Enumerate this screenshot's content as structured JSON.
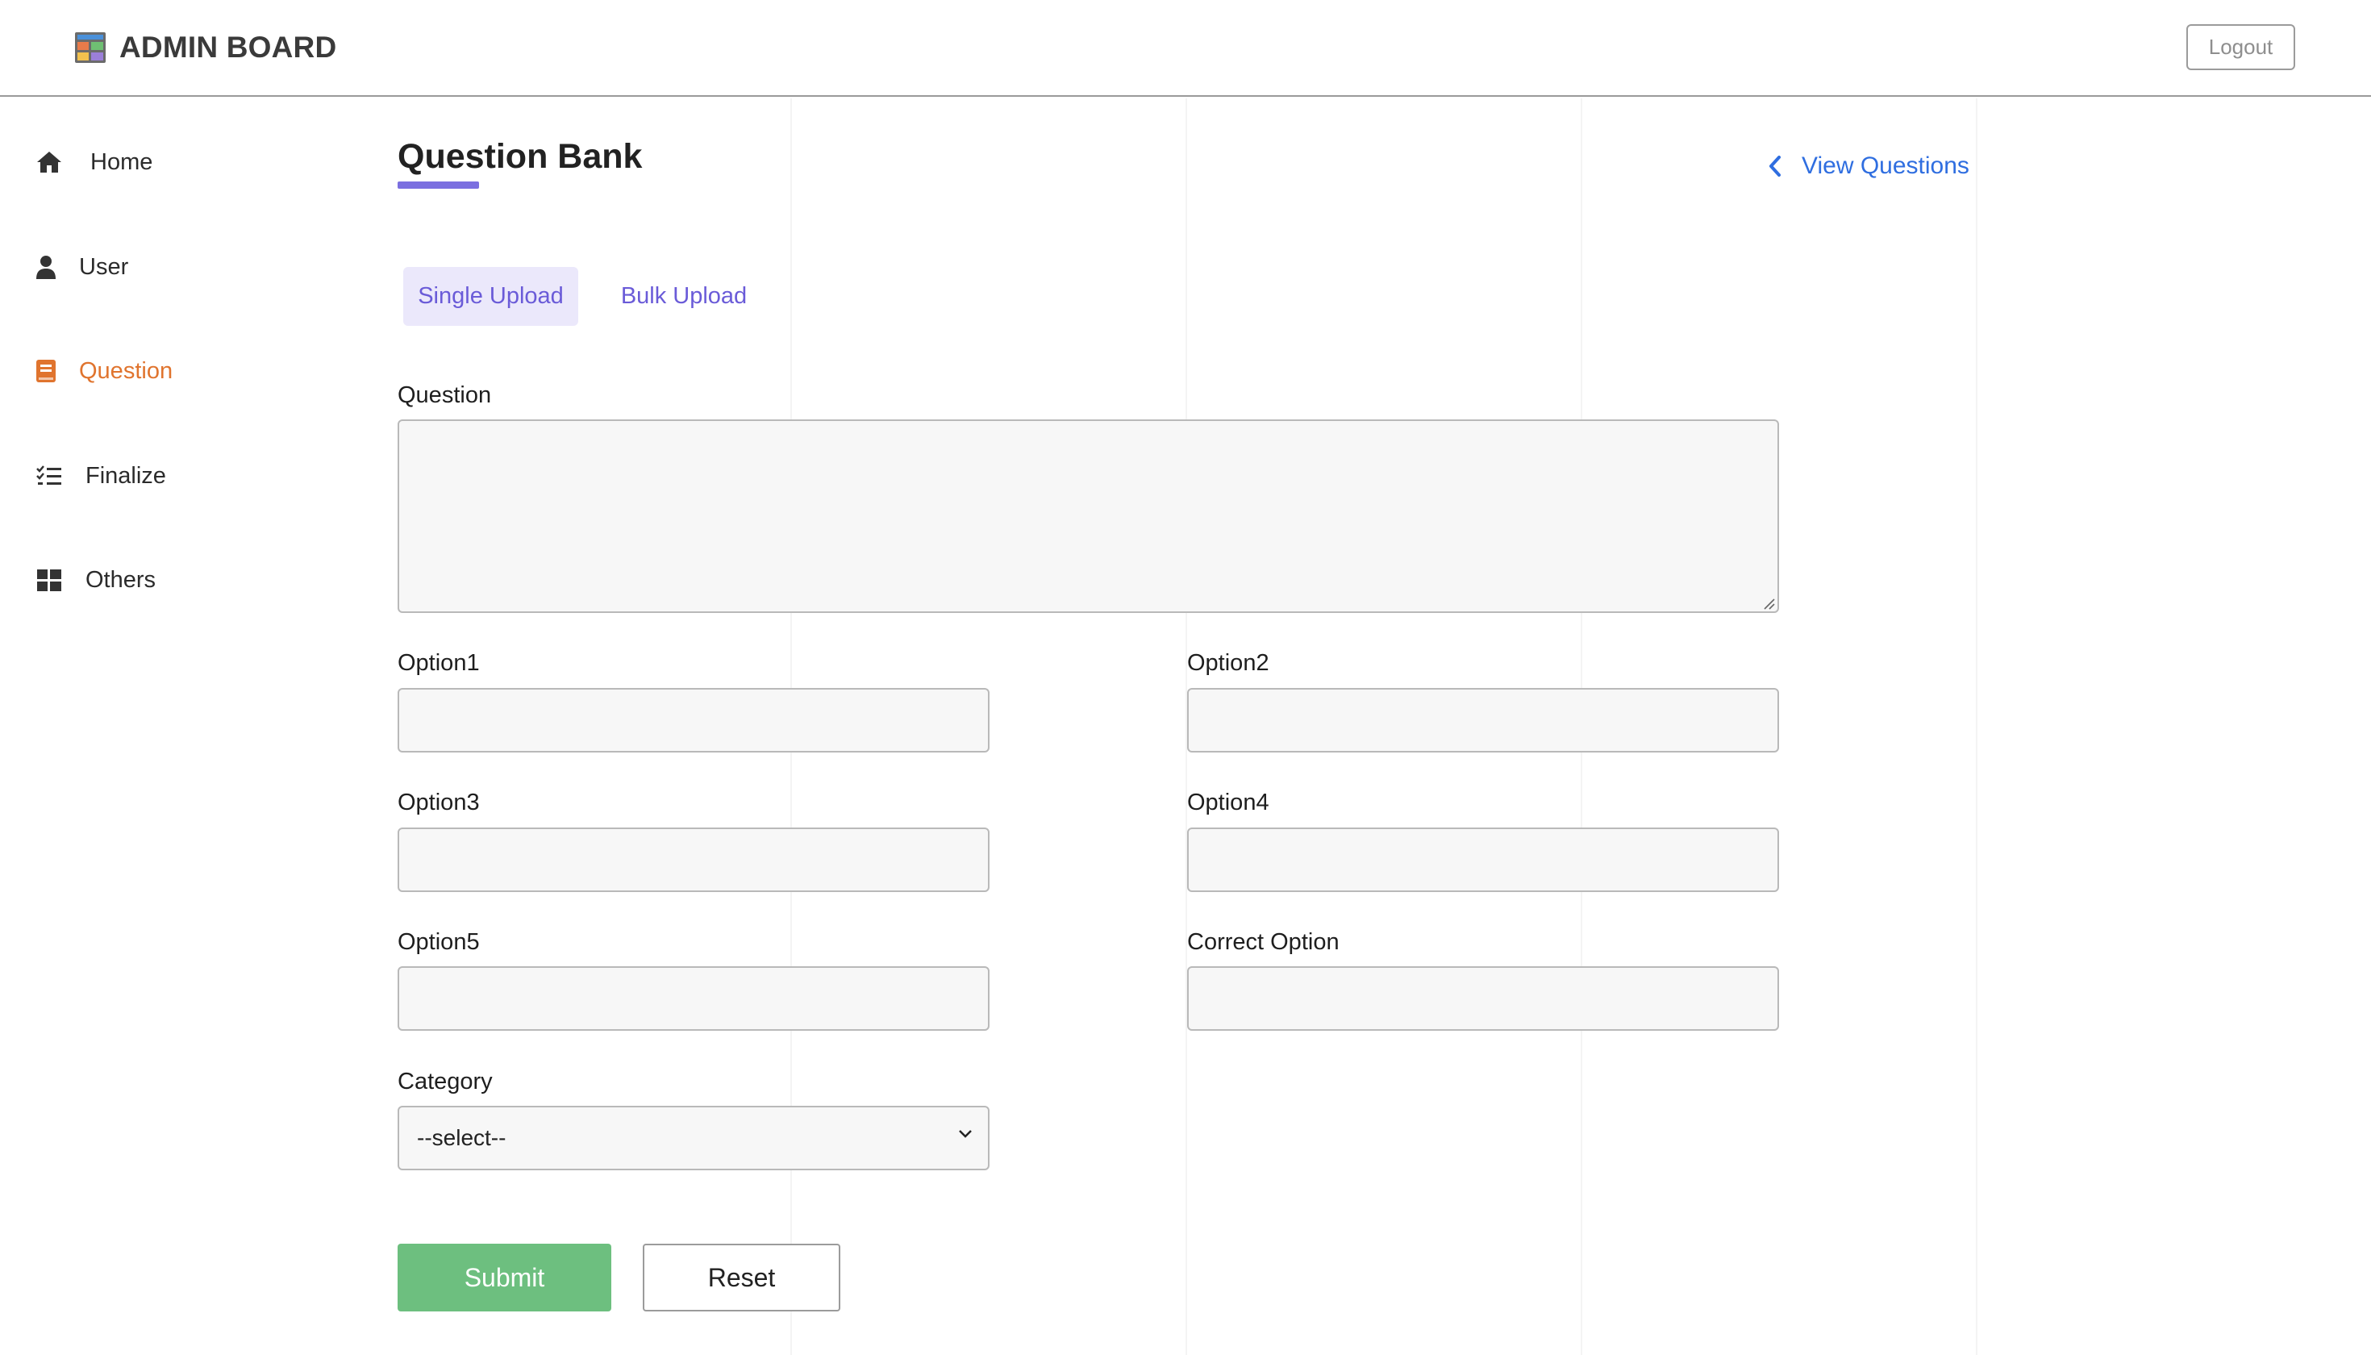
{
  "header": {
    "brand_title": "ADMIN BOARD",
    "logout_label": "Logout"
  },
  "sidebar": {
    "items": [
      {
        "label": "Home",
        "icon": "home-icon",
        "active": false
      },
      {
        "label": "User",
        "icon": "user-icon",
        "active": false
      },
      {
        "label": "Question",
        "icon": "book-icon",
        "active": true
      },
      {
        "label": "Finalize",
        "icon": "checklist-icon",
        "active": false
      },
      {
        "label": "Others",
        "icon": "grid-icon",
        "active": false
      }
    ]
  },
  "main": {
    "title": "Question Bank",
    "view_questions_label": "View Questions",
    "tabs": [
      {
        "label": "Single Upload",
        "active": true
      },
      {
        "label": "Bulk Upload",
        "active": false
      }
    ],
    "form": {
      "question_label": "Question",
      "question_value": "",
      "option1_label": "Option1",
      "option2_label": "Option2",
      "option3_label": "Option3",
      "option4_label": "Option4",
      "option5_label": "Option5",
      "correct_option_label": "Correct Option",
      "category_label": "Category",
      "category_selected": "--select--",
      "submit_label": "Submit",
      "reset_label": "Reset"
    }
  },
  "colors": {
    "accent_active": "#e0742e",
    "tab_purple": "#6a5bd8",
    "title_underline": "#7b6fe0",
    "link_blue": "#2f6ee0",
    "submit_green": "#6dbf7f"
  }
}
